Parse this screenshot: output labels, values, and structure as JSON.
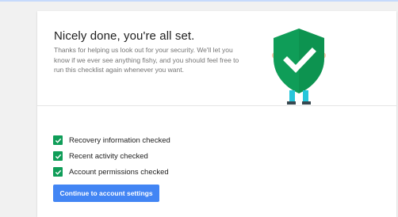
{
  "page": {
    "title": "Nicely done, you're all set.",
    "description": "Thanks for helping us look out for your security. We'll let you know if we ever see anything fishy, and you should feel free to run this checklist again whenever you want."
  },
  "checklist": {
    "items": [
      {
        "label": "Recovery information checked",
        "icon": "checkbox-checked-icon"
      },
      {
        "label": "Recent activity checked",
        "icon": "checkbox-checked-icon"
      },
      {
        "label": "Account permissions checked",
        "icon": "checkbox-checked-icon"
      }
    ]
  },
  "actions": {
    "continue_label": "Continue to account settings"
  },
  "illustration": {
    "icon": "shield-checkmark-icon"
  },
  "colors": {
    "accent_blue": "#4285f4",
    "shield_green": "#0f9d58",
    "check_green": "#0f9d58",
    "topbar": "#c6dafc"
  }
}
